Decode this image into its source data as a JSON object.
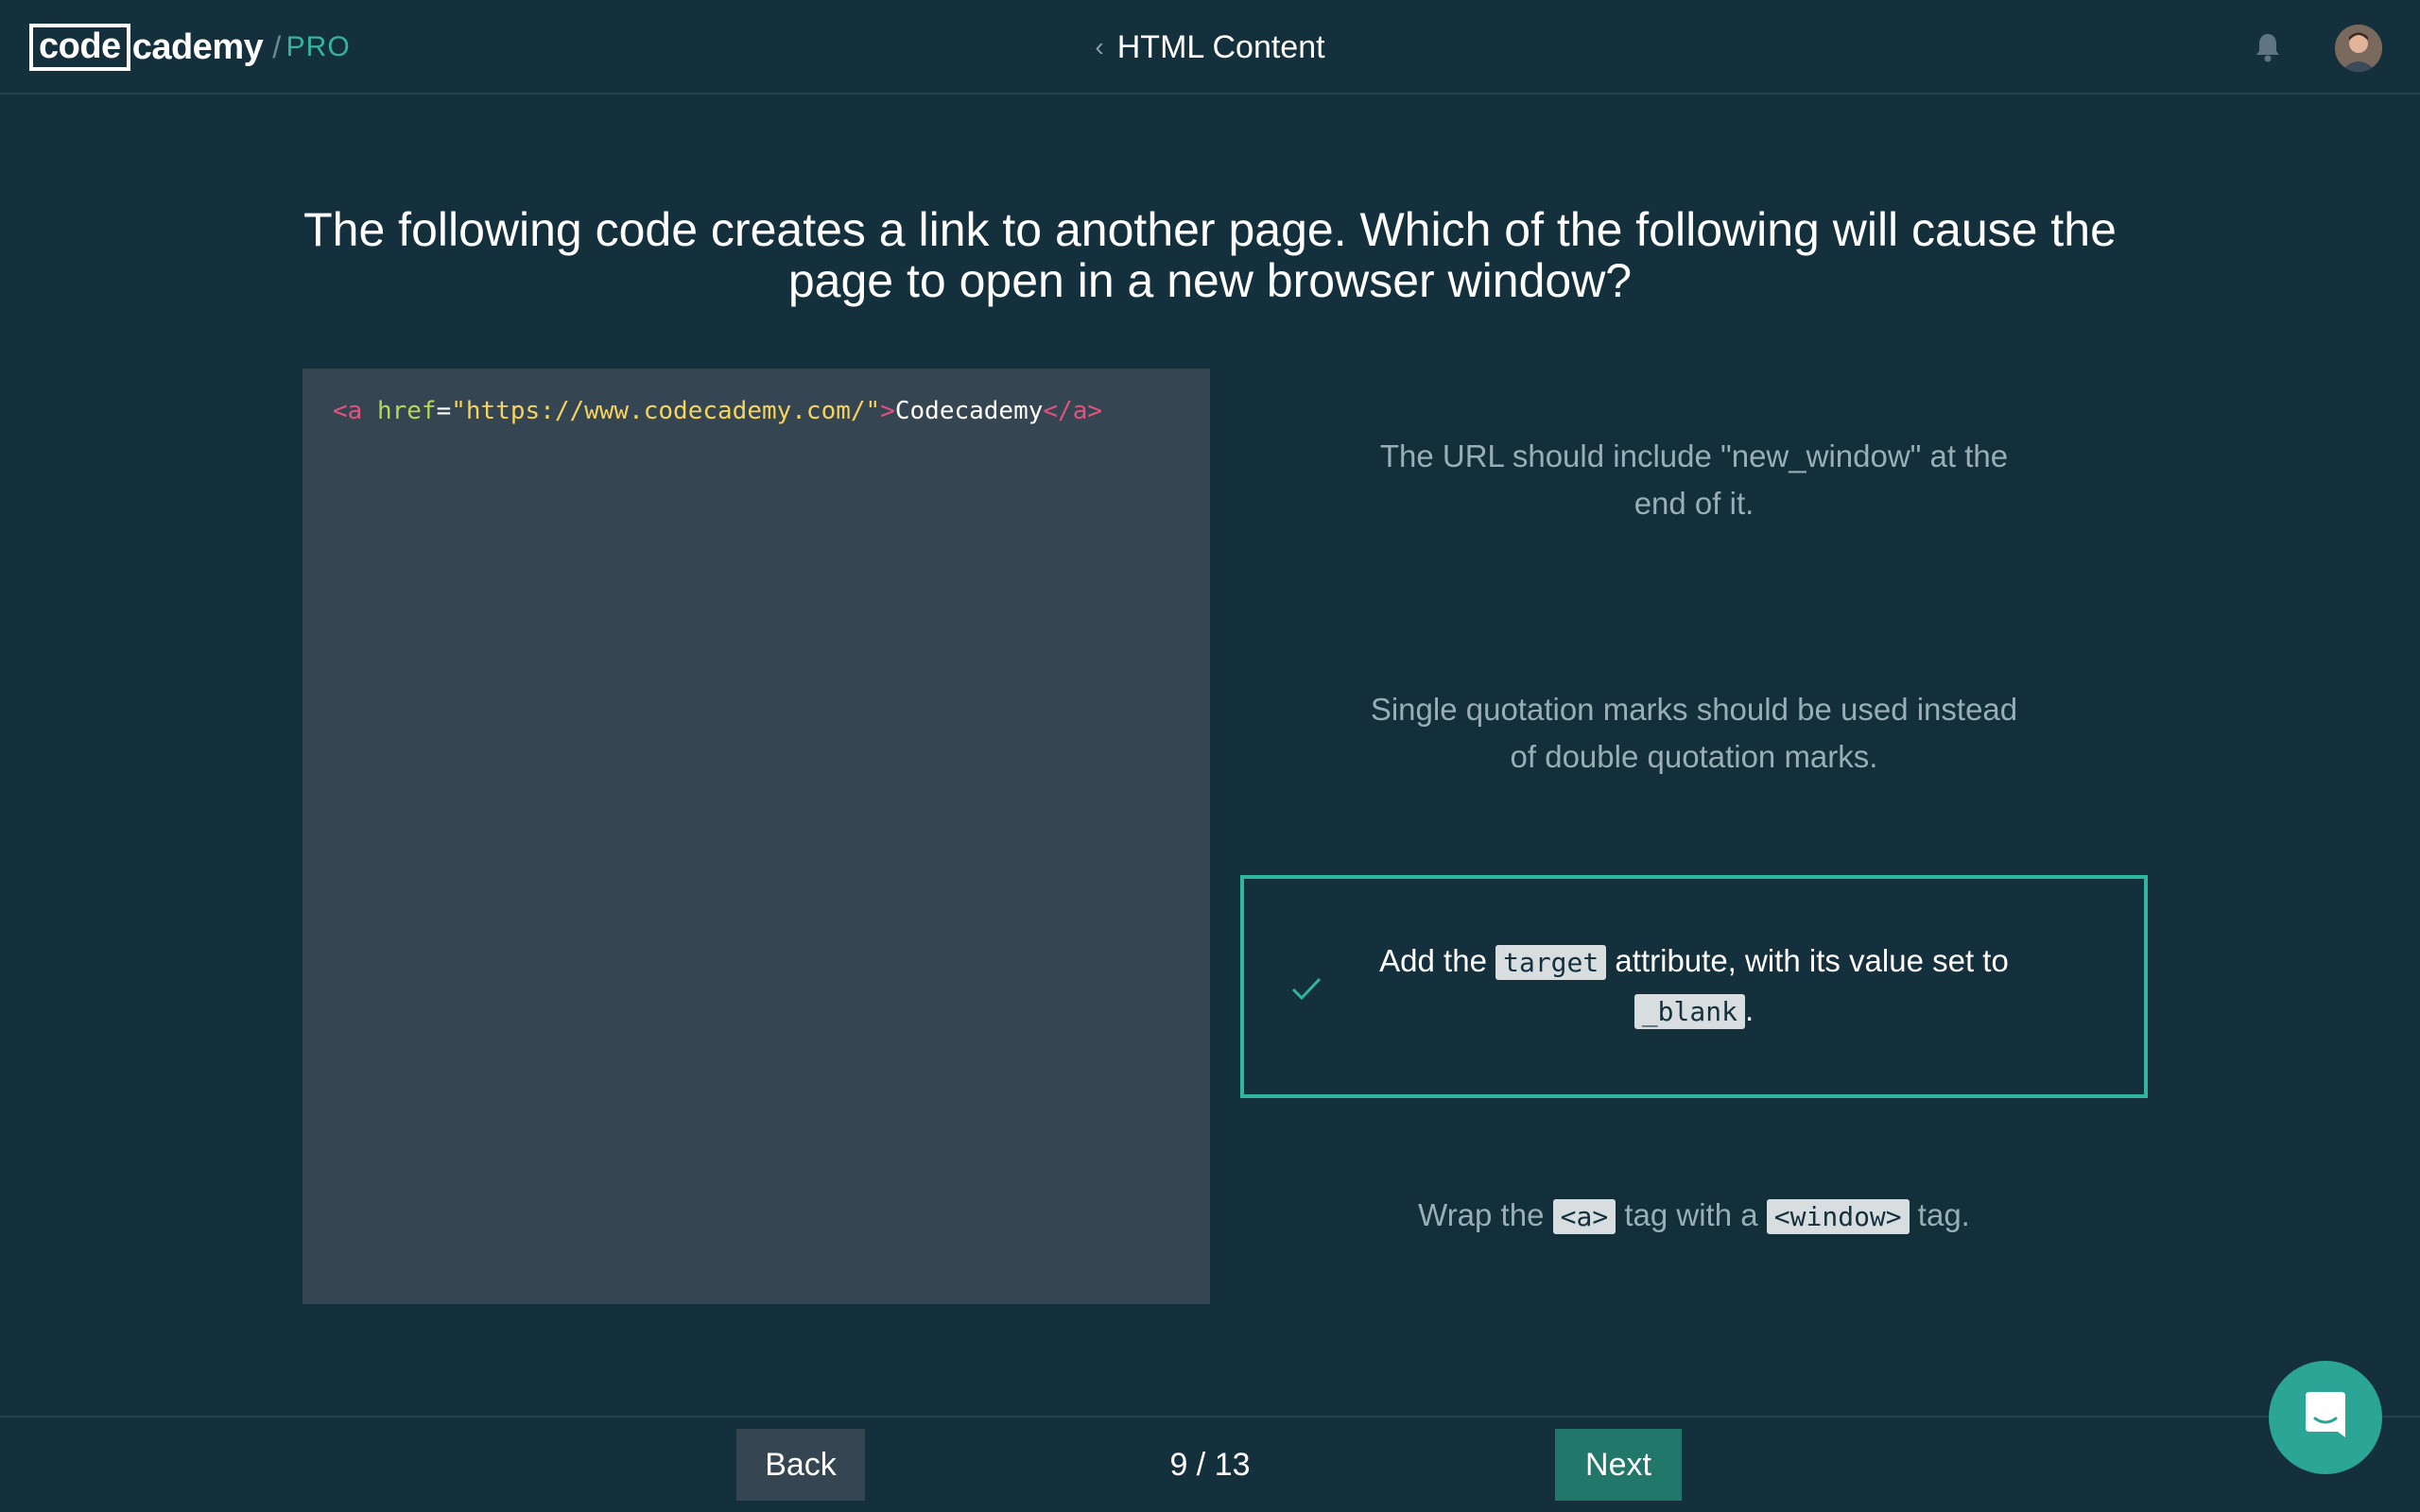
{
  "header": {
    "logo_code": "code",
    "logo_rest": "cademy",
    "logo_slash": "/",
    "logo_pro": "PRO",
    "back_chevron": "‹",
    "title": "HTML Content",
    "bell_icon": "bell-icon",
    "avatar_icon": "user-avatar"
  },
  "question": "The following code creates a link to another page. Which of the following will cause the page to open in a new browser window?",
  "code": {
    "open_tag": "<a",
    "attr": " href",
    "equals": "=",
    "value": "\"https://www.codecademy.com/\"",
    "close_bracket": ">",
    "text": "Codecademy",
    "end_tag": "</a>"
  },
  "options": [
    {
      "text": "The URL should include \"new_window\" at the end of it."
    },
    {
      "text": "Single quotation marks should be used instead of double quotation marks."
    },
    {
      "selected": true,
      "part1": "Add the ",
      "code1": "target",
      "part2": " attribute, with its value set to ",
      "code2": "_blank",
      "part3": "."
    },
    {
      "part1": "Wrap the ",
      "code1": "<a>",
      "part2": " tag with a ",
      "code2": "<window>",
      "part3": " tag."
    }
  ],
  "footer": {
    "back_label": "Back",
    "next_label": "Next",
    "page_current": 9,
    "page_total": 13,
    "page_label": "9 / 13"
  },
  "colors": {
    "background": "#15303d",
    "accent": "#2fb5a0",
    "next_button": "#22776b",
    "code_bg": "#354552"
  }
}
